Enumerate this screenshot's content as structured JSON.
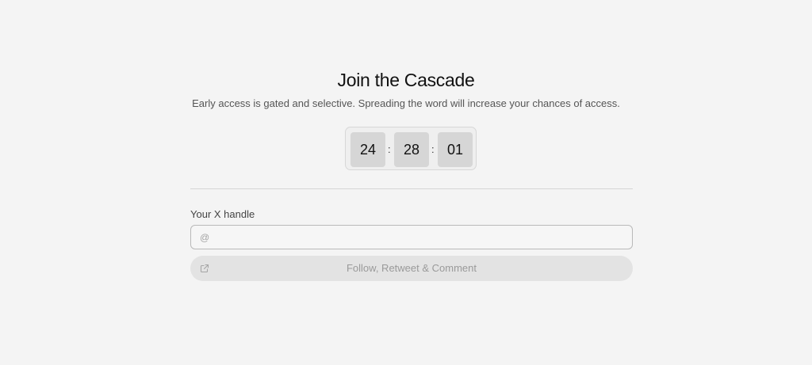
{
  "header": {
    "title": "Join the Cascade",
    "subtitle": "Early access is gated and selective. Spreading the word will increase your chances of access."
  },
  "countdown": {
    "hours": "24",
    "minutes": "28",
    "seconds": "01",
    "separator": ":"
  },
  "form": {
    "handle_label": "Your X handle",
    "handle_placeholder": "@",
    "handle_value": "",
    "action_label": "Follow, Retweet & Comment",
    "action_icon": "external-link-icon"
  },
  "colors": {
    "background": "#f4f4f4",
    "digit_box": "#d6d6d6",
    "button_bg": "#e3e3e3",
    "button_text": "#9a9a9a"
  }
}
